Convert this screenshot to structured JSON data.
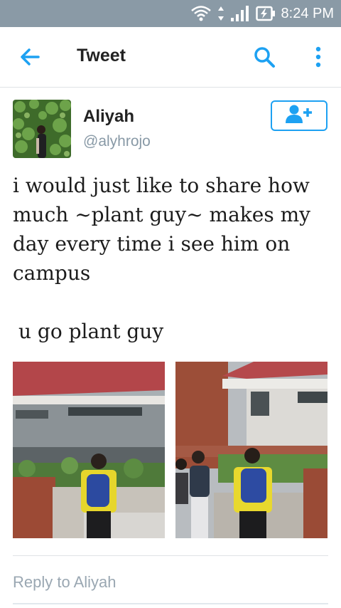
{
  "status_bar": {
    "time": "8:24 PM",
    "icons": [
      "wifi-icon",
      "data-arrows-icon",
      "signal-icon",
      "battery-charging-icon"
    ]
  },
  "app_bar": {
    "title": "Tweet",
    "icons": [
      "back-arrow-icon",
      "search-icon",
      "more-vert-icon"
    ]
  },
  "tweet": {
    "author_name": "Aliyah",
    "author_handle": "@alyhrojo",
    "follow_icon": "follow-user-icon",
    "text_lines": [
      "i would just like to share how much ~plant guy~ makes my day every time i see him on campus",
      "u go plant guy"
    ],
    "photos": 2
  },
  "reply": {
    "placeholder": "Reply to Aliyah"
  },
  "colors": {
    "accent": "#1da1f2",
    "status_bar": "#8a9aa6",
    "muted_text": "#8899a6"
  }
}
